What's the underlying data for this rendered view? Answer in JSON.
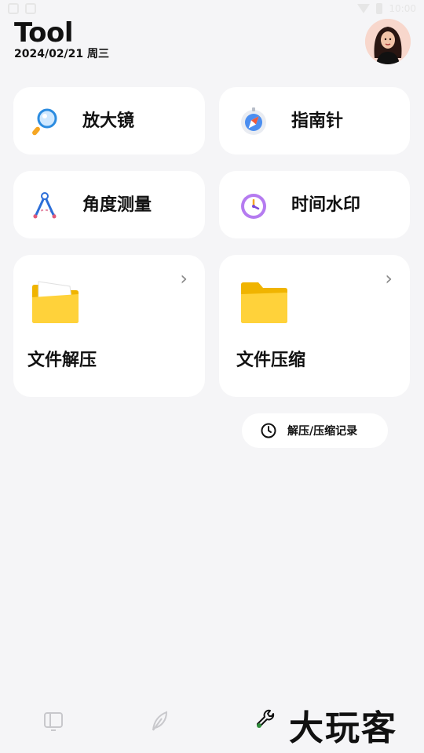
{
  "status_bar": {
    "time": "10:00"
  },
  "header": {
    "title": "Tool",
    "date": "2024/02/21 周三"
  },
  "tools": [
    {
      "label": "放大镜",
      "icon": "magnifier-icon"
    },
    {
      "label": "指南针",
      "icon": "compass-icon"
    },
    {
      "label": "角度测量",
      "icon": "protractor-icon"
    },
    {
      "label": "时间水印",
      "icon": "clock-watermark-icon"
    }
  ],
  "archive": [
    {
      "label": "文件解压",
      "icon": "folder-open-icon"
    },
    {
      "label": "文件压缩",
      "icon": "folder-icon"
    }
  ],
  "history": {
    "label": "解压/压缩记录",
    "icon": "clock-icon"
  },
  "bottom_nav": {
    "items": [
      "book-icon",
      "feather-icon",
      "wrench-icon"
    ],
    "active_color": "#2e8b3a"
  },
  "watermark": "大玩客"
}
